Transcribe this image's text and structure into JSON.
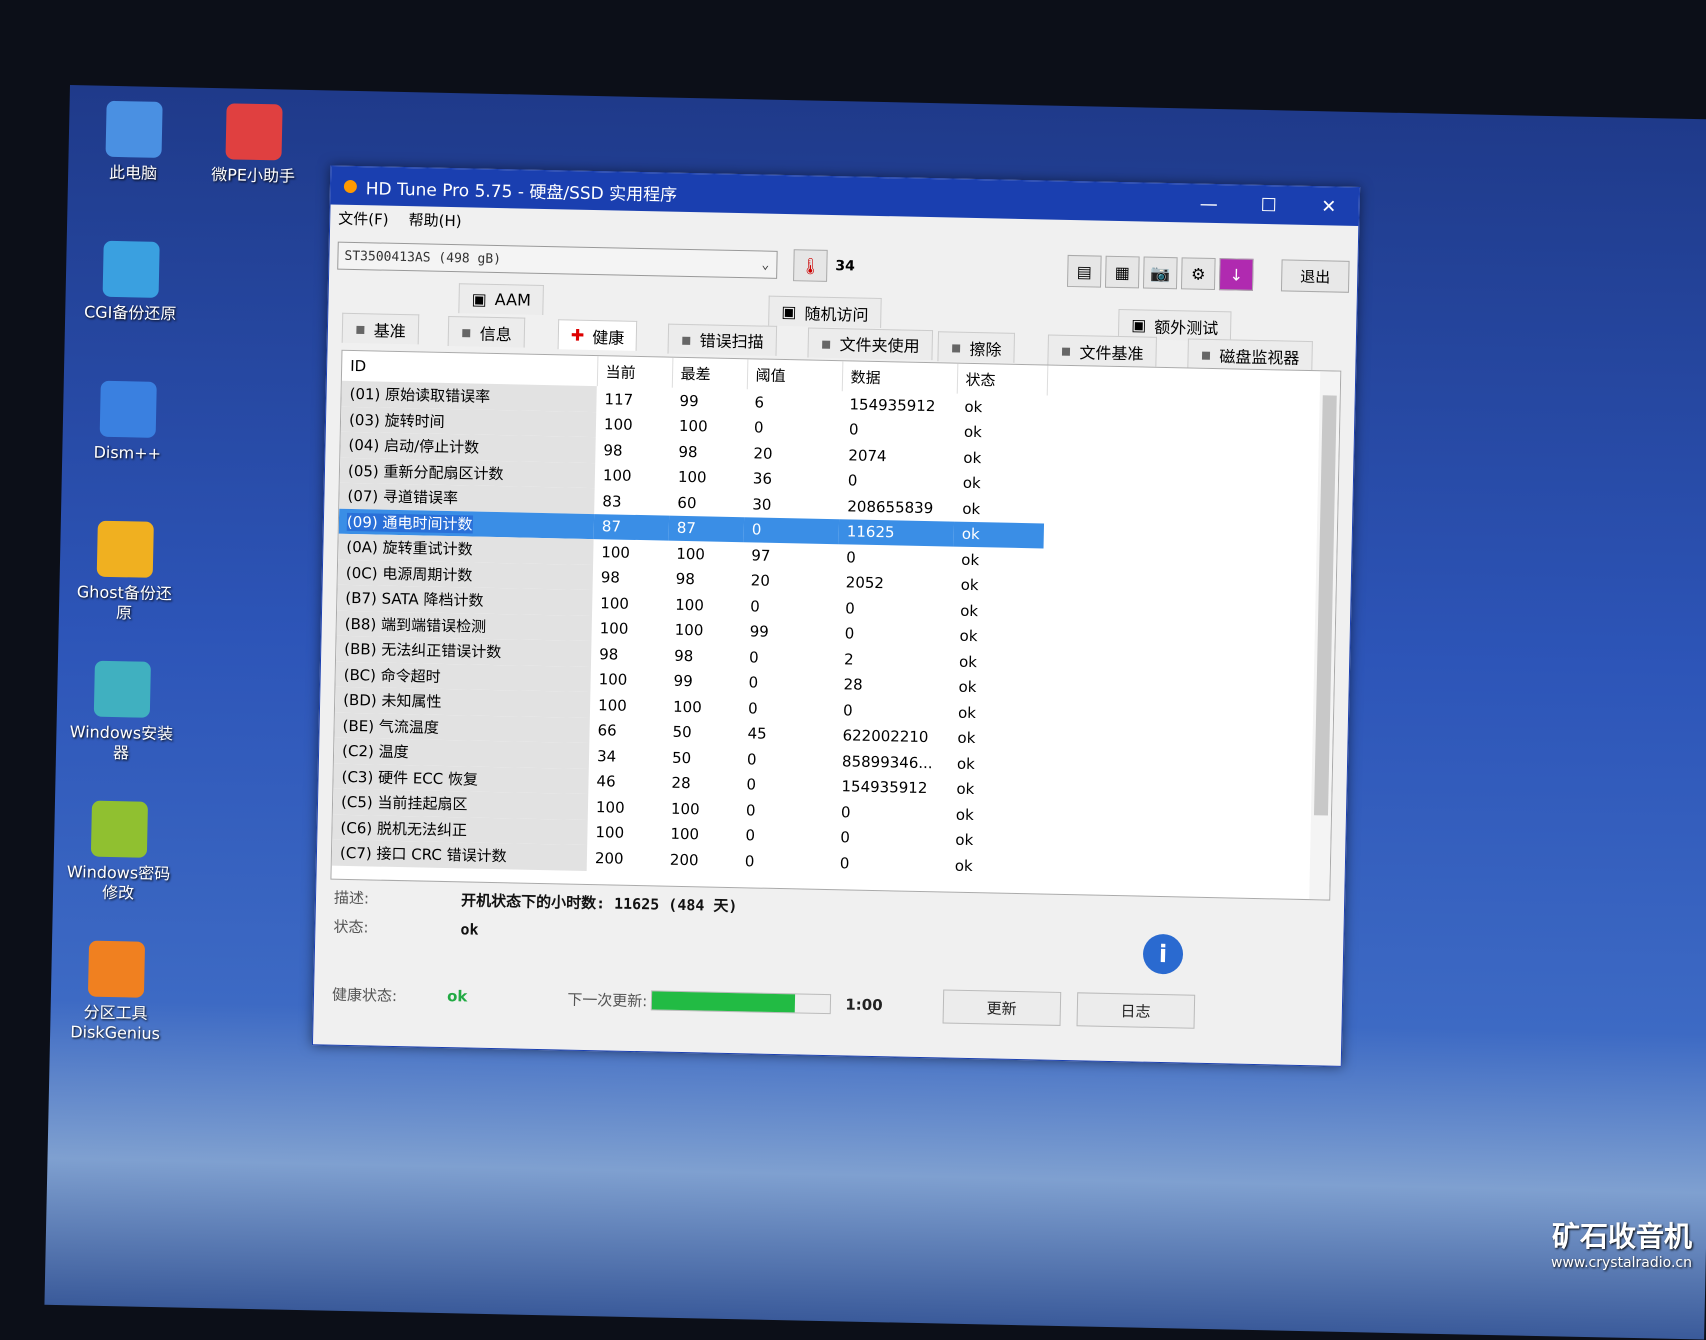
{
  "desktop": {
    "icons": [
      "此电脑",
      "微PE小助手",
      "CGI备份还原",
      "Dism++",
      "Ghost备份还原",
      "Windows安装器",
      "Windows密码修改",
      "分区工具DiskGenius"
    ]
  },
  "window": {
    "title": "HD Tune Pro 5.75 - 硬盘/SSD 实用程序",
    "menu": [
      "文件(F)",
      "帮助(H)"
    ],
    "drive": "ST3500413AS (498 gB)",
    "temperature": "34",
    "exit_label": "退出",
    "tabs_top": [
      "AAM",
      "随机访问",
      "额外测试"
    ],
    "tabs_bottom": [
      "基准",
      "信息",
      "健康",
      "错误扫描",
      "文件夹使用",
      "擦除",
      "文件基准",
      "磁盘监视器"
    ],
    "active_tab": "健康",
    "columns": [
      "ID",
      "当前",
      "最差",
      "阈值",
      "数据",
      "状态"
    ],
    "rows": [
      [
        "(01) 原始读取错误率",
        "117",
        "99",
        "6",
        "154935912",
        "ok"
      ],
      [
        "(03) 旋转时间",
        "100",
        "100",
        "0",
        "0",
        "ok"
      ],
      [
        "(04) 启动/停止计数",
        "98",
        "98",
        "20",
        "2074",
        "ok"
      ],
      [
        "(05) 重新分配扇区计数",
        "100",
        "100",
        "36",
        "0",
        "ok"
      ],
      [
        "(07) 寻道错误率",
        "83",
        "60",
        "30",
        "208655839",
        "ok"
      ],
      [
        "(09) 通电时间计数",
        "87",
        "87",
        "0",
        "11625",
        "ok"
      ],
      [
        "(0A) 旋转重试计数",
        "100",
        "100",
        "97",
        "0",
        "ok"
      ],
      [
        "(0C) 电源周期计数",
        "98",
        "98",
        "20",
        "2052",
        "ok"
      ],
      [
        "(B7) SATA 降档计数",
        "100",
        "100",
        "0",
        "0",
        "ok"
      ],
      [
        "(B8) 端到端错误检测",
        "100",
        "100",
        "99",
        "0",
        "ok"
      ],
      [
        "(BB) 无法纠正错误计数",
        "98",
        "98",
        "0",
        "2",
        "ok"
      ],
      [
        "(BC) 命令超时",
        "100",
        "99",
        "0",
        "28",
        "ok"
      ],
      [
        "(BD) 未知属性",
        "100",
        "100",
        "0",
        "0",
        "ok"
      ],
      [
        "(BE) 气流温度",
        "66",
        "50",
        "45",
        "622002210",
        "ok"
      ],
      [
        "(C2) 温度",
        "34",
        "50",
        "0",
        "85899346...",
        "ok"
      ],
      [
        "(C3) 硬件 ECC 恢复",
        "46",
        "28",
        "0",
        "154935912",
        "ok"
      ],
      [
        "(C5) 当前挂起扇区",
        "100",
        "100",
        "0",
        "0",
        "ok"
      ],
      [
        "(C6) 脱机无法纠正",
        "100",
        "100",
        "0",
        "0",
        "ok"
      ],
      [
        "(C7) 接口 CRC 错误计数",
        "200",
        "200",
        "0",
        "0",
        "ok"
      ]
    ],
    "selected_row": 5,
    "desc_label": "描述:",
    "desc_value": "开机状态下的小时数: 11625 (484 天)",
    "status_label": "状态:",
    "status_value": "ok",
    "health_label": "健康状态:",
    "health_value": "ok",
    "next_update_label": "下一次更新:",
    "next_update_progress": 0.8,
    "next_update_time": "1:00",
    "refresh_label": "更新",
    "log_label": "日志"
  },
  "watermark": {
    "title": "矿石收音机",
    "url": "www.crystalradio.cn"
  }
}
